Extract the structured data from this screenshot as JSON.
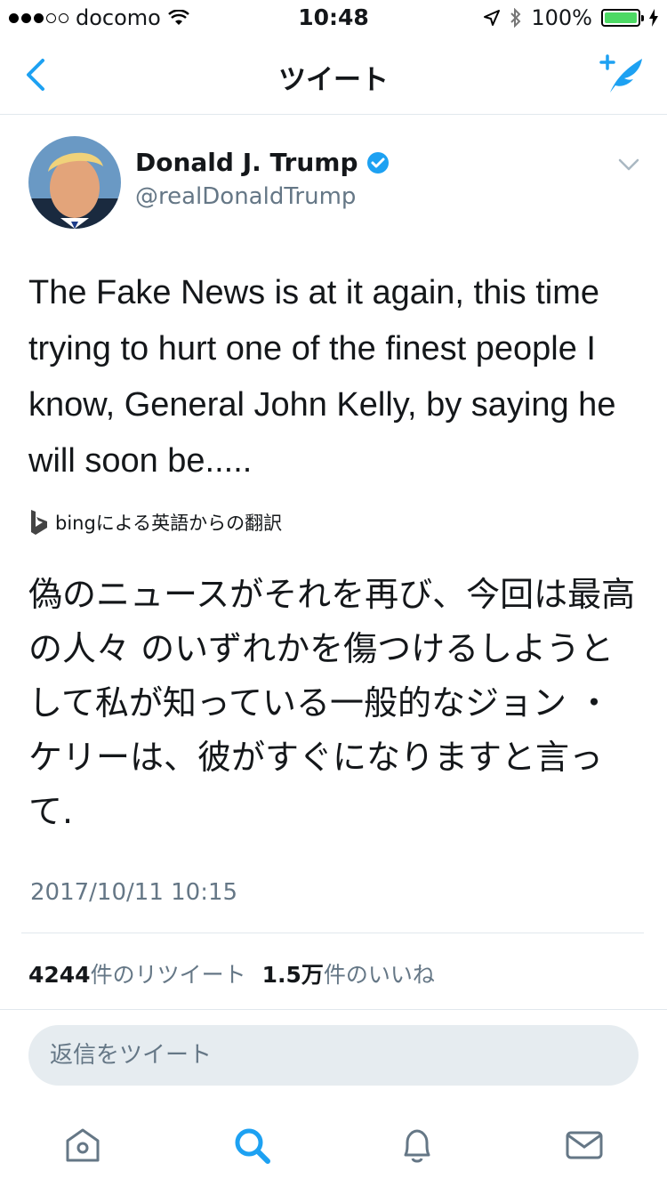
{
  "status": {
    "carrier": "docomo",
    "time": "10:48",
    "battery_pct": "100%",
    "signal_bars": 3,
    "signal_total": 5
  },
  "nav": {
    "title": "ツイート",
    "back_icon": "chevron-left-icon",
    "compose_icon": "compose-tweet-icon"
  },
  "tweet": {
    "name": "Donald J. Trump",
    "handle": "@realDonaldTrump",
    "verified": true,
    "text": "The Fake News is at it again, this time trying to hurt one of the finest people I know, General John Kelly, by saying he will soon be.....",
    "translated_by": "bingによる英語からの翻訳",
    "translation": "偽のニュースがそれを再び、今回は最高の人々 のいずれかを傷つけるしようとして私が知っている一般的なジョン ・ ケリーは、彼がすぐになりますと言って.",
    "timestamp": "2017/10/11 10:15"
  },
  "stats": {
    "retweets_count": "4244",
    "retweets_label": "件のリツイート",
    "likes_count": "1.5万",
    "likes_label": "件のいいね"
  },
  "reply": {
    "placeholder": "返信をツイート"
  },
  "tabbar": {
    "items": [
      "home-icon",
      "search-icon",
      "notifications-icon",
      "messages-icon"
    ],
    "active": "search-icon"
  },
  "colors": {
    "accent": "#1da1f2",
    "secondary_text": "#657786",
    "battery": "#4cd964"
  }
}
